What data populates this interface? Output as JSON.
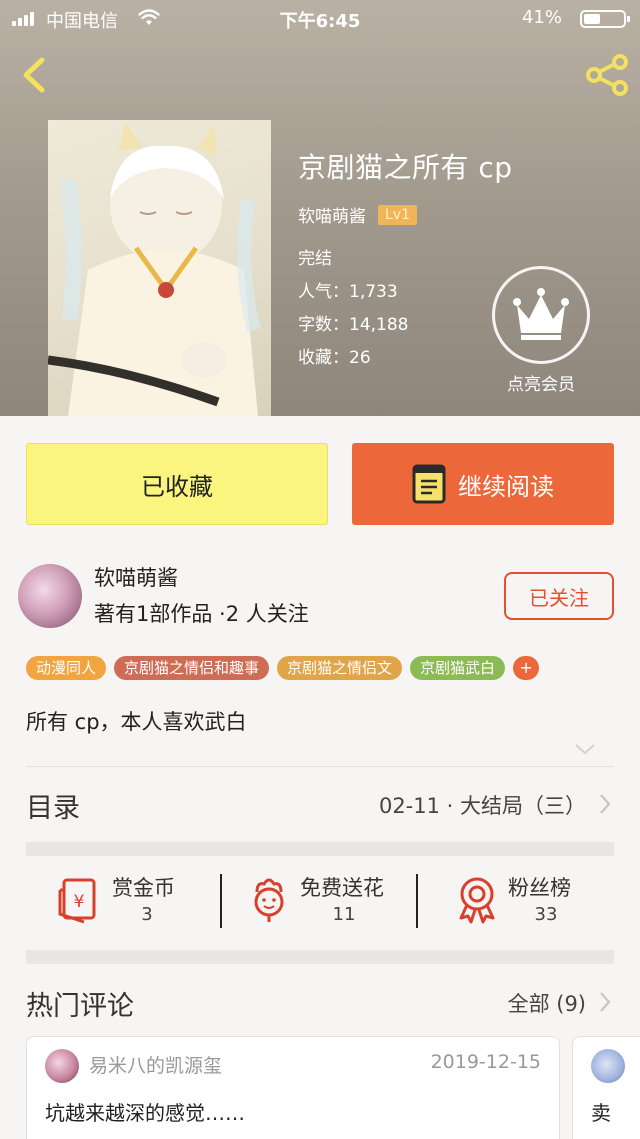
{
  "status_bar": {
    "carrier": "中国电信",
    "time": "下午6:45",
    "battery_percent": "41%",
    "battery_level": 0.41
  },
  "book": {
    "title": "京剧猫之所有 cp",
    "author": "软喵萌酱",
    "level": "Lv1",
    "status": "完结",
    "popularity_label": "人气：",
    "popularity": "1,733",
    "word_count_label": "字数：",
    "word_count": "14,188",
    "favorites_label": "收藏：",
    "favorites": "26"
  },
  "vip": {
    "label": "点亮会员"
  },
  "actions": {
    "collected_label": "已收藏",
    "continue_label": "继续阅读"
  },
  "author_block": {
    "name": "软喵萌酱",
    "stats": "著有1部作品 ·2 人关注",
    "follow_label": "已关注"
  },
  "tags": [
    {
      "label": "动漫同人",
      "color": "#f2a441"
    },
    {
      "label": "京剧猫之情侣和趣事",
      "color": "#cf6c55"
    },
    {
      "label": "京剧猫之情侣文",
      "color": "#e0a548"
    },
    {
      "label": "京剧猫武白",
      "color": "#8cbb55"
    }
  ],
  "tag_more": "+",
  "description": "所有 cp，本人喜欢武白",
  "toc": {
    "label": "目录",
    "latest": "02-11 · 大结局（三）"
  },
  "stats": [
    {
      "name": "赏金币",
      "value": "3",
      "icon": "red-envelope-icon"
    },
    {
      "name": "免费送花",
      "value": "11",
      "icon": "flower-icon"
    },
    {
      "name": "粉丝榜",
      "value": "33",
      "icon": "medal-icon"
    }
  ],
  "comments_section": {
    "label": "热门评论",
    "all_label": "全部 (9)"
  },
  "comments": [
    {
      "user": "易米八的凯源玺",
      "date": "2019-12-15",
      "text": "坑越来越深的感觉……"
    },
    {
      "user": "",
      "date": "",
      "text": "卖"
    }
  ],
  "colors": {
    "accent": "#ec683a",
    "collected_bg": "#fbf580",
    "icon_red": "#d9402b"
  }
}
